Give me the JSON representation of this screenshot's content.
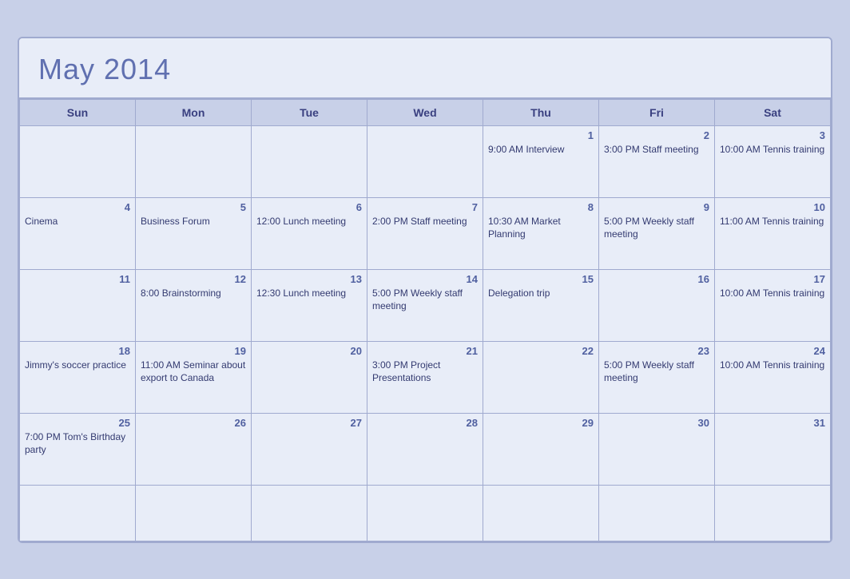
{
  "header": {
    "title": "May 2014"
  },
  "weekdays": [
    "Sun",
    "Mon",
    "Tue",
    "Wed",
    "Thu",
    "Fri",
    "Sat"
  ],
  "weeks": [
    [
      {
        "day": null,
        "event": ""
      },
      {
        "day": null,
        "event": ""
      },
      {
        "day": null,
        "event": ""
      },
      {
        "day": null,
        "event": ""
      },
      {
        "day": "1",
        "event": "9:00 AM Interview"
      },
      {
        "day": "2",
        "event": "3:00 PM Staff meeting"
      },
      {
        "day": "3",
        "event": "10:00 AM Tennis training"
      }
    ],
    [
      {
        "day": "4",
        "event": "Cinema"
      },
      {
        "day": "5",
        "event": "Business Forum"
      },
      {
        "day": "6",
        "event": "12:00 Lunch meeting"
      },
      {
        "day": "7",
        "event": "2:00 PM Staff meeting"
      },
      {
        "day": "8",
        "event": "10:30 AM Market Planning"
      },
      {
        "day": "9",
        "event": "5:00 PM Weekly staff meeting"
      },
      {
        "day": "10",
        "event": "11:00 AM Tennis training"
      }
    ],
    [
      {
        "day": "11",
        "event": ""
      },
      {
        "day": "12",
        "event": "8:00 Brainstorming"
      },
      {
        "day": "13",
        "event": "12:30 Lunch meeting"
      },
      {
        "day": "14",
        "event": "5:00 PM Weekly staff meeting"
      },
      {
        "day": "15",
        "event": "Delegation trip"
      },
      {
        "day": "16",
        "event": ""
      },
      {
        "day": "17",
        "event": "10:00 AM Tennis training"
      }
    ],
    [
      {
        "day": "18",
        "event": "Jimmy's soccer practice"
      },
      {
        "day": "19",
        "event": "11:00 AM Seminar about export to Canada"
      },
      {
        "day": "20",
        "event": ""
      },
      {
        "day": "21",
        "event": "3:00 PM Project Presentations"
      },
      {
        "day": "22",
        "event": ""
      },
      {
        "day": "23",
        "event": "5:00 PM Weekly staff meeting"
      },
      {
        "day": "24",
        "event": "10:00 AM Tennis training"
      }
    ],
    [
      {
        "day": "25",
        "event": "7:00 PM Tom's Birthday party"
      },
      {
        "day": "26",
        "event": ""
      },
      {
        "day": "27",
        "event": ""
      },
      {
        "day": "28",
        "event": ""
      },
      {
        "day": "29",
        "event": ""
      },
      {
        "day": "30",
        "event": ""
      },
      {
        "day": "31",
        "event": ""
      }
    ],
    [
      {
        "day": null,
        "event": ""
      },
      {
        "day": null,
        "event": ""
      },
      {
        "day": null,
        "event": ""
      },
      {
        "day": null,
        "event": ""
      },
      {
        "day": null,
        "event": ""
      },
      {
        "day": null,
        "event": ""
      },
      {
        "day": null,
        "event": ""
      }
    ]
  ]
}
